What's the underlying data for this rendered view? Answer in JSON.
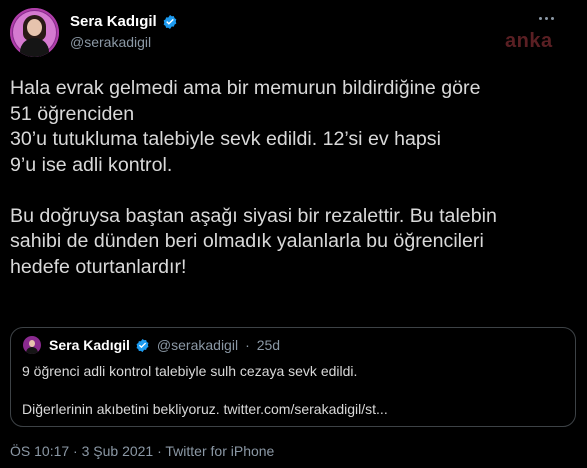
{
  "tweet": {
    "author_name": "Sera Kadıgil",
    "author_handle": "@serakadigil",
    "text": "Hala evrak gelmedi ama bir memurun bildirdiğine göre\n51 öğrenciden\n30’u tutukluma talebiyle sevk edildi. 12’si ev hapsi\n9’u ise adli kontrol.\n\nBu doğruysa baştan aşağı siyasi bir rezalettir. Bu talebin\nsahibi de dünden beri olmadık yalanlarla bu öğrencileri\nhedefe oturtanlardır!",
    "footer": "ÖS 10:17 · 3 Şub 2021 · Twitter for iPhone"
  },
  "watermark": "anka",
  "quote": {
    "author_name": "Sera Kadıgil",
    "author_handle": "@serakadigil",
    "age": "25d",
    "text": "9 öğrenci adli kontrol talebiyle sulh cezaya sevk edildi.\n\nDiğerlerinin akıbetini bekliyoruz. twitter.com/serakadigil/st..."
  },
  "colors": {
    "background": "#000000",
    "text": "#d9d9d9",
    "secondary": "#8b98a5",
    "verified": "#1d9bf0",
    "border": "#3d4246"
  },
  "icons": [
    "avatar",
    "verified-badge-icon",
    "more-options-icon"
  ]
}
